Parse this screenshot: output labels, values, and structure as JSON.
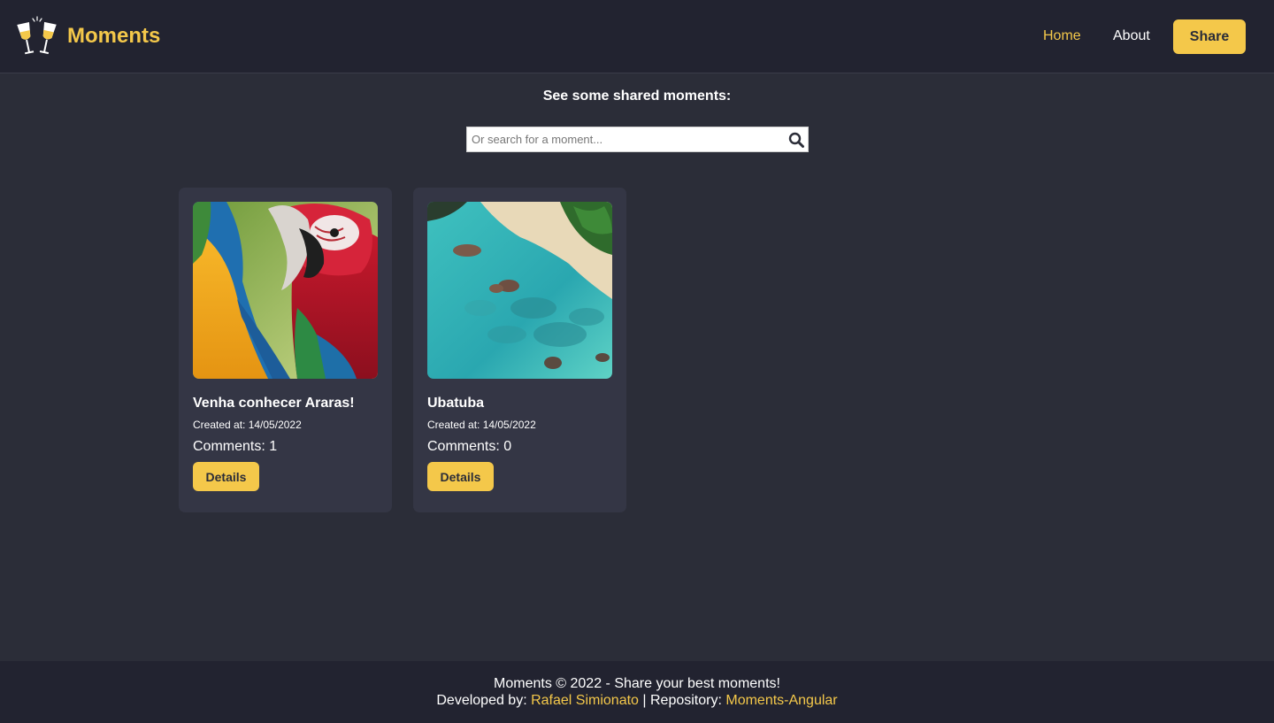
{
  "header": {
    "brand": "Moments",
    "logo_icon": "champagne-toast-icon",
    "nav": {
      "home": "Home",
      "about": "About",
      "share": "Share"
    },
    "accent_color": "#f4c84a"
  },
  "main": {
    "title": "See some shared moments:",
    "search": {
      "placeholder": "Or search for a moment...",
      "value": "",
      "icon": "search-icon"
    },
    "moments": [
      {
        "title": "Venha conhecer Araras!",
        "created_at": "Created at: 14/05/2022",
        "comments": "Comments: 1",
        "details_label": "Details",
        "image": "macaws-photo"
      },
      {
        "title": "Ubatuba",
        "created_at": "Created at: 14/05/2022",
        "comments": "Comments: 0",
        "details_label": "Details",
        "image": "beach-aerial-photo"
      }
    ]
  },
  "footer": {
    "copyright": "Moments © 2022 - Share your best moments!",
    "developed_by": "Developed by: ",
    "developer": "Rafael Simionato",
    "separator": " | Repository: ",
    "repository": "Moments-Angular"
  }
}
